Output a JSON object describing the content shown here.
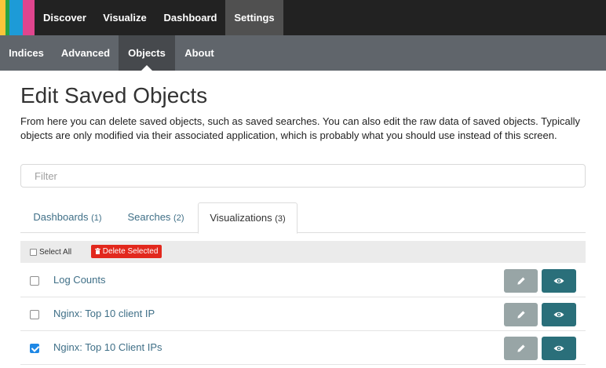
{
  "brand": {
    "colors": [
      "#f9c53a",
      "#25a244",
      "#1d9bd7",
      "#e0458e"
    ]
  },
  "topnav": {
    "items": [
      {
        "label": "Discover"
      },
      {
        "label": "Visualize"
      },
      {
        "label": "Dashboard"
      },
      {
        "label": "Settings",
        "active": true
      }
    ]
  },
  "subnav": {
    "items": [
      {
        "label": "Indices"
      },
      {
        "label": "Advanced"
      },
      {
        "label": "Objects",
        "active": true
      },
      {
        "label": "About"
      }
    ]
  },
  "main": {
    "title": "Edit Saved Objects",
    "description": "From here you can delete saved objects, such as saved searches. You can also edit the raw data of saved objects. Typically objects are only modified via their associated application, which is probably what you should use instead of this screen.",
    "filter": {
      "placeholder": "Filter",
      "value": ""
    },
    "tabs": [
      {
        "label": "Dashboards",
        "count": "(1)"
      },
      {
        "label": "Searches",
        "count": "(2)"
      },
      {
        "label": "Visualizations",
        "count": "(3)",
        "active": true
      }
    ],
    "toolbar": {
      "select_all_label": "Select All",
      "delete_icon": "trash-icon",
      "delete_label": "Delete Selected"
    },
    "objects": [
      {
        "title": "Log Counts",
        "checked": false
      },
      {
        "title": "Nginx: Top 10 client IP",
        "checked": false
      },
      {
        "title": "Nginx: Top 10 Client IPs",
        "checked": true
      }
    ],
    "row_actions": {
      "edit_icon": "pencil-icon",
      "view_icon": "eye-icon"
    }
  }
}
